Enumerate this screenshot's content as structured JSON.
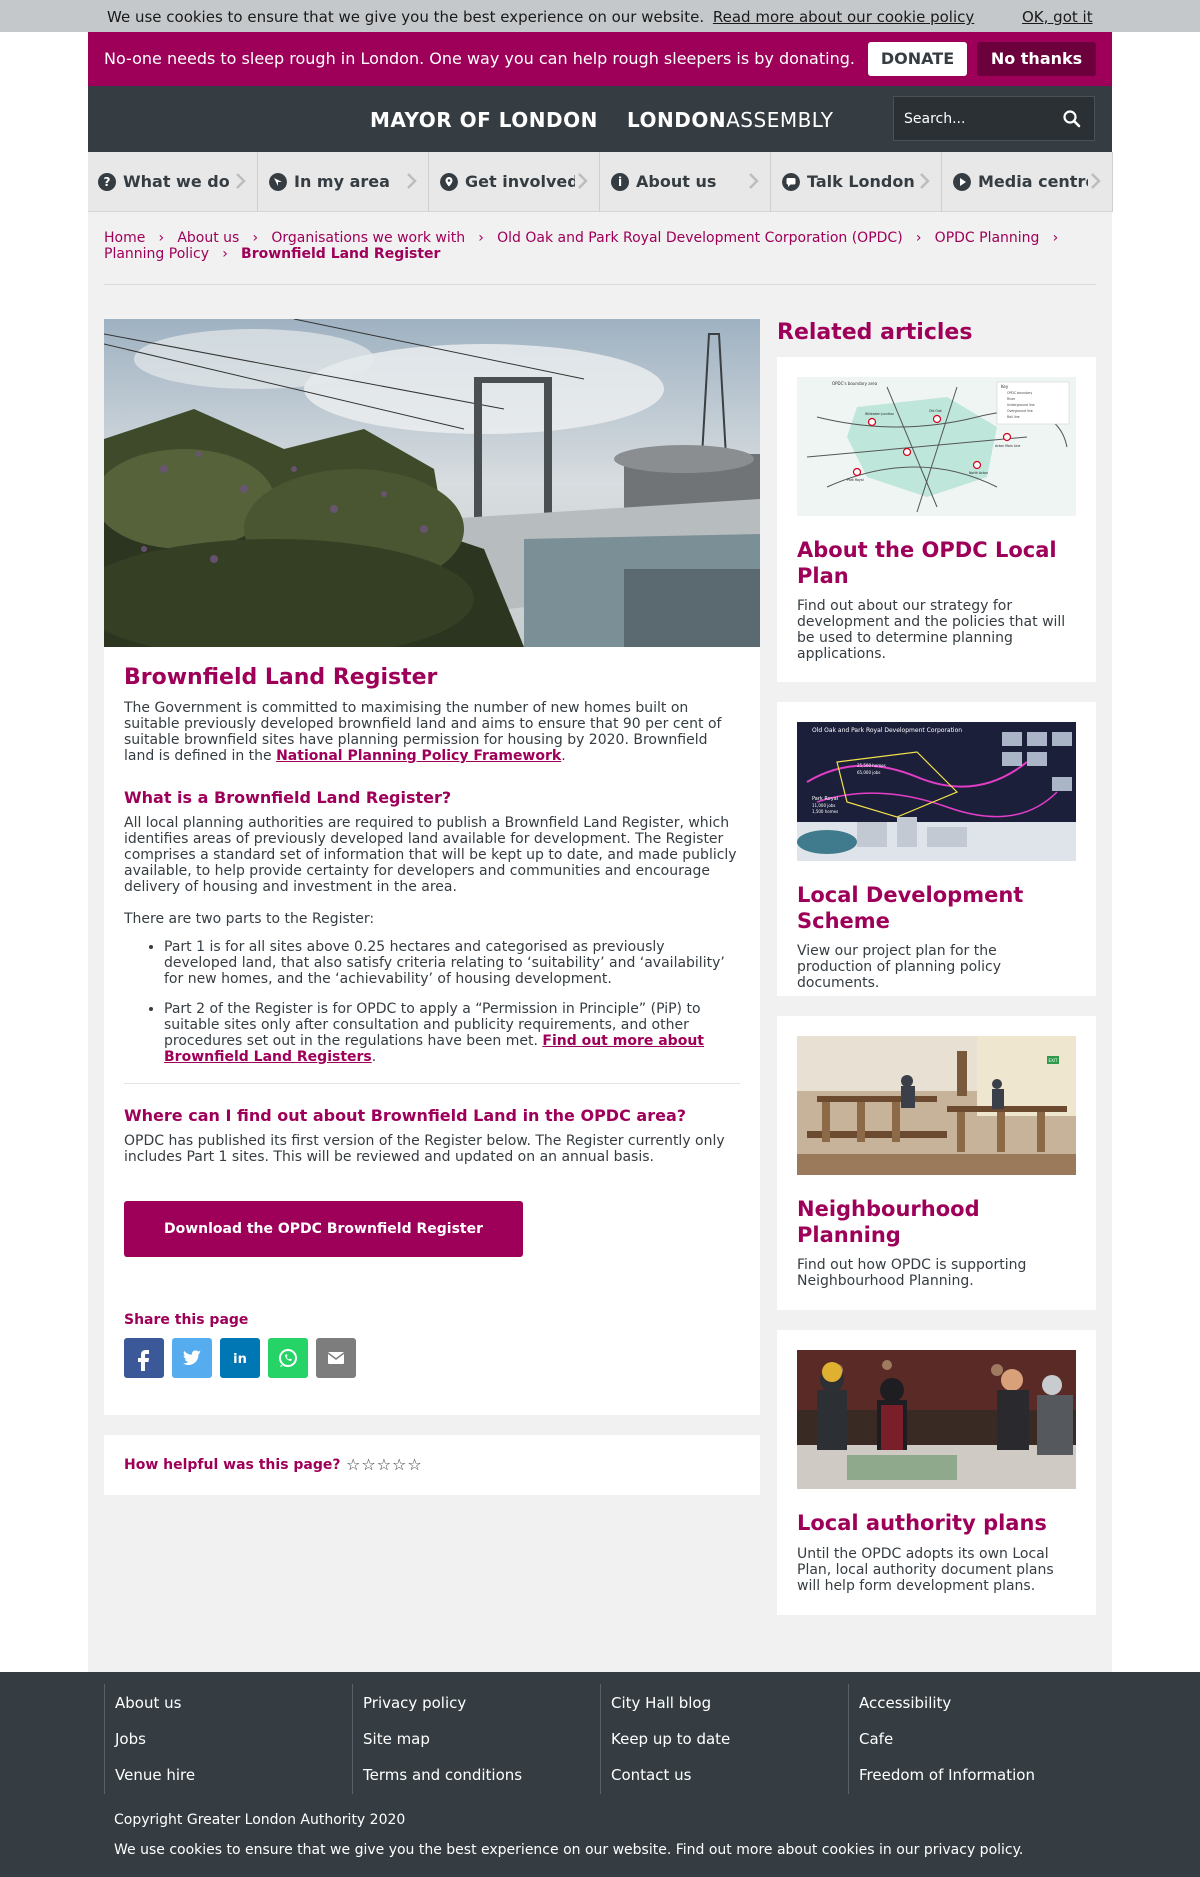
{
  "cookie_bar": {
    "text": "We use cookies to ensure that we give you the best experience on our website.",
    "link": "Read more about our cookie policy",
    "ok": "OK, got it"
  },
  "donate_banner": {
    "message": "No-one needs to sleep rough in London. One way you can help rough sleepers is by donating.",
    "donate": "DONATE",
    "no_thanks": "No thanks"
  },
  "header": {
    "mayor_logo": "MAYOR OF LONDON",
    "assembly_logo_bold": "LONDON",
    "assembly_logo_rest": "ASSEMBLY",
    "search_placeholder": "Search..."
  },
  "nav": {
    "items": [
      {
        "label": "What we do",
        "icon": "question-icon"
      },
      {
        "label": "In my area",
        "icon": "compass-icon"
      },
      {
        "label": "Get involved",
        "icon": "map-pin-icon"
      },
      {
        "label": "About us",
        "icon": "info-icon"
      },
      {
        "label": "Talk London",
        "icon": "chat-icon"
      },
      {
        "label": "Media centre",
        "icon": "play-icon"
      }
    ]
  },
  "breadcrumb": {
    "items": [
      "Home",
      "About us",
      "Organisations we work with",
      "Old Oak and Park Royal Development Corporation (OPDC)",
      "OPDC Planning",
      "Planning Policy"
    ],
    "current": "Brownfield Land Register"
  },
  "article": {
    "title": "Brownfield Land Register",
    "intro": "The Government is committed to maximising the number of new homes built on suitable previously developed brownfield land and aims to ensure that 90 per cent of suitable brownfield sites have planning permission for housing by 2020. Brownfield land is defined in the ",
    "intro_link": "National Planning Policy Framework",
    "intro_end": ".",
    "h2_what": "What is a Brownfield Land Register?",
    "what_para": "All local planning authorities are required to publish a Brownfield Land Register, which identifies areas of previously developed land available for development. The Register comprises a standard set of information that will be kept up to date, and made publicly available, to help provide certainty for developers and communities and encourage delivery of housing and investment in the area.",
    "parts_intro": "There are two parts to the Register:",
    "part1": "Part 1 is for all sites above 0.25 hectares and categorised as previously developed land, that also satisfy criteria relating to ‘suitability’ and ‘availability’ for new homes, and the ‘achievability’ of housing development.",
    "part2": "Part 2 of the Register is for OPDC to apply a “Permission in Principle” (PiP) to suitable sites only after consultation and publicity requirements, and other procedures set out in the regulations have been met. ",
    "part2_link": "Find out more about Brownfield Land Registers",
    "part2_end": ".",
    "h2_where": "Where can I find out about Brownfield Land in the OPDC area?",
    "where_para": "OPDC has published its first version of the Register below. The Register currently only includes Part 1 sites. This will be reviewed and updated on an annual basis.",
    "download": "Download the OPDC Brownfield Register",
    "share_title": "Share this page",
    "share": [
      {
        "name": "facebook",
        "glyph": "f",
        "color": "#3b5998"
      },
      {
        "name": "twitter",
        "glyph": "t",
        "color": "#55acee"
      },
      {
        "name": "linkedin",
        "glyph": "in",
        "color": "#0077b5"
      },
      {
        "name": "whatsapp",
        "glyph": "w",
        "color": "#25d366"
      },
      {
        "name": "email",
        "glyph": "@",
        "color": "#7d7d7d"
      }
    ]
  },
  "helpful": {
    "question": "How helpful was this page?",
    "stars": "☆☆☆☆☆",
    "rating": 0
  },
  "sidebar": {
    "title": "Related articles",
    "articles": [
      {
        "title": "About the OPDC Local Plan",
        "text": "Find out about our strategy for development and the policies that will be used to determine planning applications."
      },
      {
        "title": "Local Development Scheme",
        "text": "View our project plan for the production of planning policy documents."
      },
      {
        "title": "Neighbourhood Planning",
        "text": "Find out how OPDC is supporting Neighbourhood Planning."
      },
      {
        "title": "Local authority plans",
        "text": "Until the OPDC adopts its own Local Plan, local authority document plans will help form development plans."
      }
    ],
    "map_card": {
      "map_title": "OPDC's boundary area",
      "key_title": "Key",
      "key_items": [
        "OPDC boundary",
        "River",
        "Underground line",
        "Overground line",
        "Rail line"
      ],
      "stations": [
        "Willesden Junction",
        "Old Oak",
        "North Acton",
        "Acton Main Line",
        "Park Royal"
      ]
    },
    "board_card": {
      "title": "Old Oak and Park Royal Development Corporation",
      "stat1": "25,500 homes",
      "stat2": "65,000 jobs",
      "stat3": "Park Royal",
      "stat4": "11,000 jobs",
      "stat5": "1,500 homes"
    },
    "poster_card": {
      "exit_sign": "EXIT"
    }
  },
  "footer": {
    "columns": [
      [
        "About us",
        "Jobs",
        "Venue hire"
      ],
      [
        "Privacy policy",
        "Site map",
        "Terms and conditions"
      ],
      [
        "City Hall blog",
        "Keep up to date",
        "Contact us"
      ],
      [
        "Accessibility",
        "Cafe",
        "Freedom of Information"
      ]
    ],
    "copyright": "Copyright Greater London Authority 2020",
    "cookie_note": "We use cookies to ensure that we give you the best experience on our website. Find out more about cookies in our privacy policy."
  }
}
